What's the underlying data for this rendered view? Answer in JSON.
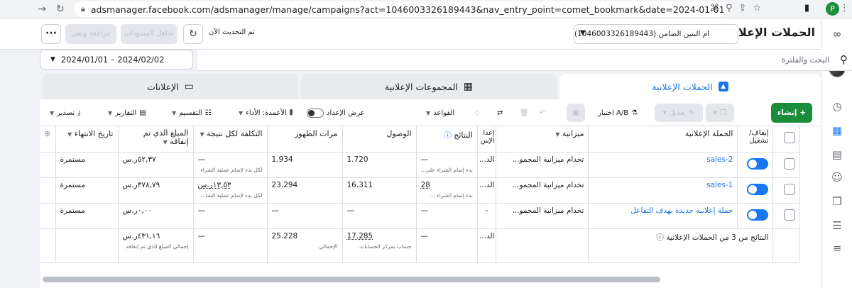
{
  "browser": {
    "url": "adsmanager.facebook.com/adsmanager/manage/campaigns?act=1046003326189443&nav_entry_point=comet_bookmark&date=2024-01-01_2024-02-03&i...",
    "profile_initial": "P"
  },
  "header": {
    "title": "الحملات الإعلانية",
    "account": "ام البنين الضامن (1046003326189443)",
    "updated_label": "تم التحديث الآن",
    "discard_label": "تجاهل المسودات",
    "review_label": "مراجعة ونشر"
  },
  "search": {
    "placeholder": "البحث والفلترة",
    "date_range": "2024/01/01 – 2024/02/02"
  },
  "tabs": {
    "campaigns": "الحملات الإعلانية",
    "adsets": "المجموعات الإعلانية",
    "ads": "الإعلانات"
  },
  "toolbar": {
    "create": "إنشاء",
    "edit": "تعديل",
    "ab_test": "اختبار A/B",
    "rules": "القواعد",
    "view_setup": "عرض الإعداد",
    "columns": "الأعمدة: الأداء",
    "breakdown": "التقسيم",
    "reports": "التقارير",
    "export": "تصدير"
  },
  "table": {
    "headers": {
      "toggle": "إيقاف/ تشغيل",
      "campaign": "الحملة الإعلانية",
      "budget": "ميزانية",
      "delivery": "إعدا الإس",
      "results": "النتائج",
      "reach": "الوصول",
      "impressions": "مرات الظهور",
      "cost_per_result": "التكلفة لكل نتيجة",
      "amount_spent": "المبلغ الذي تم إنفاقه",
      "end_date": "تاريخ الانتهاء"
    },
    "rows": [
      {
        "campaign": "sales-2",
        "budget": "تخدام ميزانية المجمو...",
        "delivery": "الد...",
        "results": "—",
        "results_sub": "بدء إتمام الشراء علی...",
        "reach": "1.720",
        "impressions": "1.934",
        "cost": "—",
        "cost_sub": "لكل بدء لإتمام عملية الشراء",
        "spent": "٥٢,٣٧ر.س",
        "end": "مستمرة"
      },
      {
        "campaign": "sales-1",
        "budget": "تخدام ميزانية المجمو...",
        "delivery": "الد...",
        "results": "28",
        "results_sub": "بدء إتمام الشراء ...",
        "reach": "16.311",
        "impressions": "23.294",
        "cost": "١٣,٥٣ر.س",
        "cost_sub": "لكل بدء لإتمام عملية الشا...",
        "spent": "٣٧٨,٧٩ر.س",
        "end": "مستمرة"
      },
      {
        "campaign": "حملة إعلانية جديدة بهدف التفاعل",
        "budget": "تخدام ميزانية المجمو...",
        "delivery": "-",
        "results": "—",
        "results_sub": "",
        "reach": "—",
        "impressions": "—",
        "cost": "—",
        "cost_sub": "",
        "spent": "٠,٠٠ر.س",
        "end": "مستمرة"
      }
    ],
    "total": {
      "label": "النتائج من 3 من الحملات الإعلانية",
      "delivery": "الد...",
      "results": "—",
      "reach": "17.285",
      "reach_sub": "حساب بمركز الحسابات",
      "impressions": "25.228",
      "impressions_sub": "الإجمالي",
      "cost": "—",
      "spent": "٤٣١,١٦ر.س",
      "spent_sub": "إجمالي المبلغ الذي تم إنفاقه"
    }
  }
}
